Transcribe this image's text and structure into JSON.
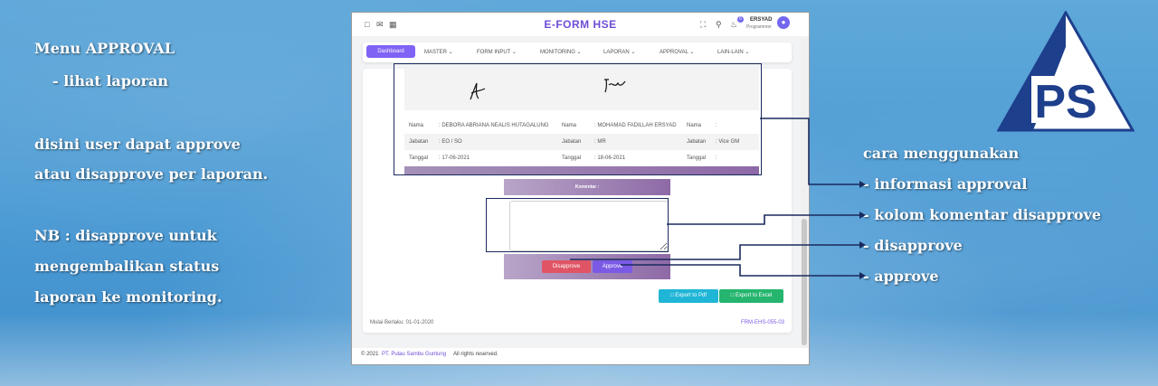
{
  "left_notes": {
    "title": "Menu APPROVAL",
    "sub": "- lihat laporan",
    "desc1": "disini user dapat approve",
    "desc2": "atau disapprove per laporan.",
    "nb1": "NB : disapprove untuk",
    "nb2": "mengembalikan status",
    "nb3": "laporan ke monitoring."
  },
  "right_notes": {
    "heading": "cara menggunakan",
    "items": [
      "- informasi approval",
      "- kolom komentar disapprove",
      "- disapprove",
      "- approve"
    ]
  },
  "logo": {
    "text": "PS"
  },
  "app": {
    "title": "E-FORM HSE",
    "notification_count": "6",
    "user_name": "ERSYAD",
    "user_role": "Programmer"
  },
  "nav": {
    "items": [
      "Dashboard",
      "MASTER ⌄",
      "FORM INPUT ⌄",
      "MONITORING ⌄",
      "LAPORAN ⌄",
      "APPROVAL ⌄",
      "LAIN-LAIN ⌄"
    ]
  },
  "approval": {
    "col1": {
      "nama_label": "Nama",
      "nama": ": DEBORA ABRIANA NEALIS HUTAGALUNG",
      "jabatan_label": "Jabatan",
      "jabatan": ": EO / SO",
      "tanggal_label": "Tanggal",
      "tanggal": ": 17-06-2021"
    },
    "col2": {
      "nama_label": "Nama",
      "nama": ": MOHAMAD FADILLAH ERSYAD",
      "jabatan_label": "Jabatan",
      "jabatan": ": MR",
      "tanggal_label": "Tanggal",
      "tanggal": ": 18-06-2021"
    },
    "col3": {
      "nama_label": "Nama",
      "nama": ":",
      "jabatan_label": "Jabatan",
      "jabatan": ": Vice GM",
      "tanggal_label": "Tanggal",
      "tanggal": ":"
    }
  },
  "komentar": {
    "label": "Komentar :",
    "value": ""
  },
  "buttons": {
    "disapprove": "Disapprove",
    "approve": "Approve",
    "export_pdf": "Export to Pdf",
    "export_excel": "Export to Excel"
  },
  "doc": {
    "mulai_berlaku": "Mulai Berlaku: 01-01-2020",
    "form_code": "FRM-EHS-055-03"
  },
  "footer": {
    "copyright": "© 2021",
    "company": "PT. Pulau Sambu Guntung",
    "rights": "All rights reserved."
  },
  "colors": {
    "brand": "#6d4ed6",
    "disapprove": "#e05565",
    "approve": "#7b5be6",
    "pdf": "#1fb5d6",
    "excel": "#25b56e"
  }
}
